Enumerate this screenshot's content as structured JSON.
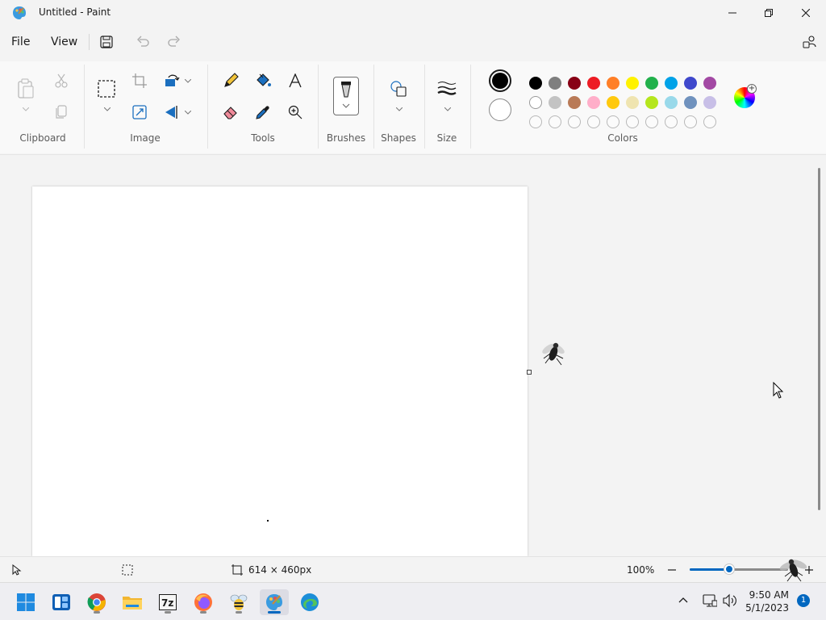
{
  "window": {
    "title": "Untitled - Paint"
  },
  "menu": {
    "file": "File",
    "view": "View"
  },
  "groups": {
    "clipboard": "Clipboard",
    "image": "Image",
    "tools": "Tools",
    "brushes": "Brushes",
    "shapes": "Shapes",
    "size": "Size",
    "colors": "Colors"
  },
  "colors": {
    "primary": "#000000",
    "secondary": "#ffffff",
    "row1": [
      "#000000",
      "#7f7f7f",
      "#880015",
      "#ed1c24",
      "#ff7f27",
      "#fff200",
      "#22b14c",
      "#00a2e8",
      "#3f48cc",
      "#a349a4"
    ],
    "row2": [
      "#ffffff",
      "#c3c3c3",
      "#b97a57",
      "#ffaec9",
      "#ffc90e",
      "#efe4b0",
      "#b5e61d",
      "#99d9ea",
      "#7092be",
      "#c8bfe7"
    ],
    "row3_empty_count": 10
  },
  "status": {
    "canvas_size": "614 × 460px",
    "zoom": "100%",
    "zoom_fraction": 0.4
  },
  "taskbar": {
    "time": "9:50 AM",
    "date": "5/1/2023",
    "notification_count": "1"
  },
  "accent": "#0067c0"
}
